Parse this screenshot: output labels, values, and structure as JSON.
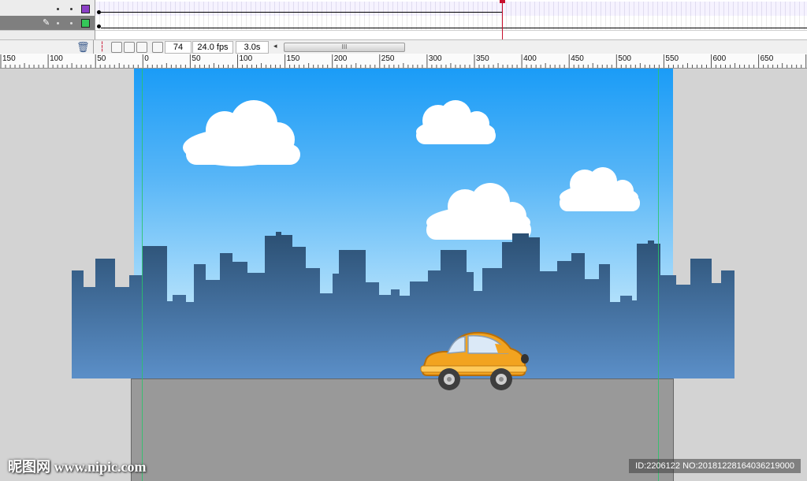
{
  "timeline": {
    "layers": [
      {
        "name": "",
        "color": "#8b3fc6",
        "selected": false
      },
      {
        "name": "",
        "color": "#34c759",
        "selected": true
      }
    ],
    "frame_field": "74",
    "fps_field": "24.0 fps",
    "time_field": "3.0s",
    "scroll_grip": "III"
  },
  "ruler": {
    "labels": [
      "150",
      "100",
      "50",
      "0",
      "50",
      "100",
      "150",
      "200",
      "250",
      "300",
      "350",
      "400",
      "450",
      "500",
      "550",
      "600",
      "650"
    ]
  },
  "watermark": {
    "left": "昵图网 www.nipic.com",
    "right": "ID:2206122 NO:20181228164036219000"
  },
  "colors": {
    "sky_top": "#1a9cf7",
    "sky_bottom": "#b3e1fb",
    "buildings": "#3c6a96",
    "road": "#999999",
    "car": "#f2a320",
    "guide": "#29c46a"
  }
}
